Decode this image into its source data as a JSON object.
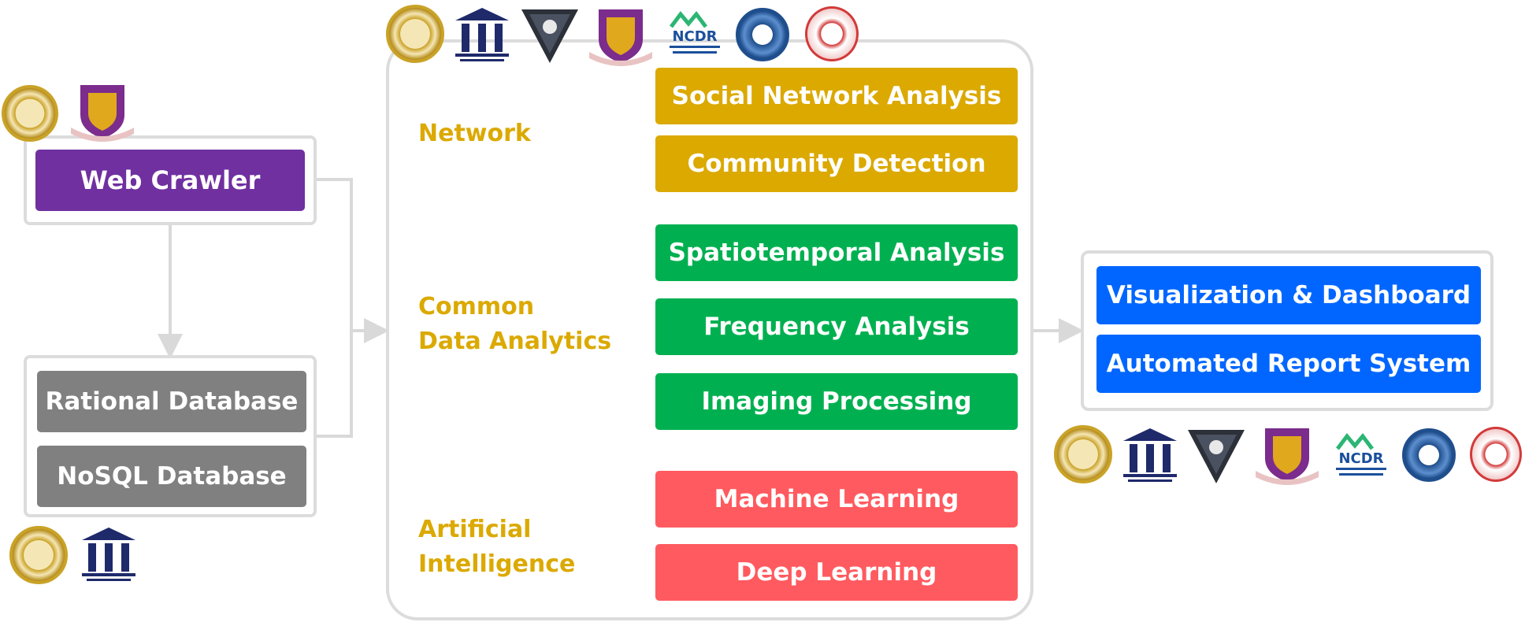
{
  "colors": {
    "crawler": "#7030a0",
    "database": "#808080",
    "network": "#dba900",
    "analytics": "#00b050",
    "ai": "#ff5a5f",
    "output": "#0066ff",
    "category_text": "#dba900",
    "frame": "#dcdcdc"
  },
  "left": {
    "crawler": {
      "label": "Web Crawler"
    },
    "databases": [
      {
        "label": "Rational Database"
      },
      {
        "label": "NoSQL Database"
      }
    ]
  },
  "center": {
    "categories": [
      {
        "label": "Network",
        "items": [
          "Social Network Analysis",
          "Community Detection"
        ]
      },
      {
        "label_lines": [
          "Common",
          "Data Analytics"
        ],
        "items": [
          "Spatiotemporal Analysis",
          "Frequency Analysis",
          "Imaging Processing"
        ]
      },
      {
        "label_lines": [
          "Artificial",
          "Intelligence"
        ],
        "items": [
          "Machine Learning",
          "Deep Learning"
        ]
      }
    ]
  },
  "right": {
    "outputs": [
      {
        "label": "Visualization & Dashboard"
      },
      {
        "label": "Automated Report System"
      }
    ]
  },
  "logos": {
    "ncdr": "NCDR"
  }
}
